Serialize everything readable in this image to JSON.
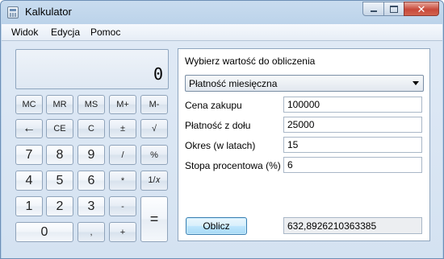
{
  "window": {
    "title": "Kalkulator"
  },
  "menu": {
    "items": [
      "Widok",
      "Edycja",
      "Pomoc"
    ]
  },
  "display": {
    "value": "0"
  },
  "keypad": {
    "row1": [
      "MC",
      "MR",
      "MS",
      "M+",
      "M-"
    ],
    "row2": [
      "←",
      "CE",
      "C",
      "±",
      "√"
    ],
    "row3": [
      "7",
      "8",
      "9",
      "/",
      "%"
    ],
    "row4": [
      "4",
      "5",
      "6",
      "*",
      "1/𝑥"
    ],
    "row5": [
      "1",
      "2",
      "3",
      "-",
      "="
    ],
    "row6": [
      "0",
      ",",
      "+"
    ]
  },
  "mortgage": {
    "prompt": "Wybierz wartość do obliczenia",
    "selected": "Płatność miesięczna",
    "fields": [
      {
        "label": "Cena zakupu",
        "value": "100000"
      },
      {
        "label": "Płatność z dołu",
        "value": "25000"
      },
      {
        "label": "Okres (w latach)",
        "value": "15"
      },
      {
        "label": "Stopa procentowa (%)",
        "value": "6"
      }
    ],
    "calc_label": "Oblicz",
    "result": "632,8926210363385"
  }
}
